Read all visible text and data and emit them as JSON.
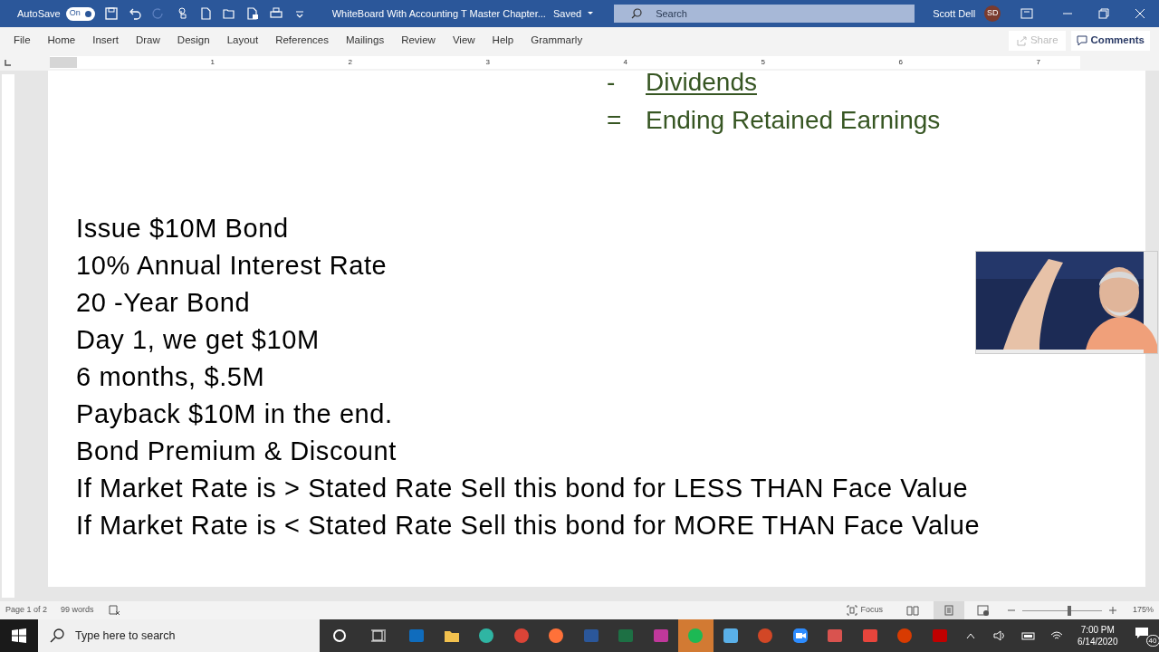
{
  "title_bar": {
    "autosave_label": "AutoSave",
    "autosave_on": true,
    "autosave_state": "On",
    "document_title": "WhiteBoard With Accounting T Master Chapter...",
    "save_status": "Saved",
    "search_placeholder": "Search",
    "user_name": "Scott Dell",
    "user_initials": "SD"
  },
  "ribbon": {
    "tabs": [
      "File",
      "Home",
      "Insert",
      "Draw",
      "Design",
      "Layout",
      "References",
      "Mailings",
      "Review",
      "View",
      "Help",
      "Grammarly"
    ],
    "share": {
      "label": "Share",
      "disabled": true
    },
    "comments": "Comments"
  },
  "ruler": {
    "numbers": [
      "1",
      "2",
      "3",
      "4",
      "5",
      "6",
      "7"
    ]
  },
  "document": {
    "summary_lines": [
      {
        "symbol": "-",
        "text": "Dividends",
        "underlined": true
      },
      {
        "symbol": "=",
        "text": "Ending Retained Earnings",
        "underlined": false
      }
    ],
    "lines": [
      "Issue $10M Bond",
      "10% Annual Interest Rate",
      "20 -Year Bond",
      "Day 1, we get $10M",
      "6 months, $.5M",
      "Payback $10M in the end.",
      "Bond Premium & Discount",
      "If Market Rate is > Stated Rate Sell this bond for LESS THAN Face Value",
      "If Market Rate is < Stated Rate Sell this bond for MORE THAN Face Value"
    ]
  },
  "status_bar": {
    "page": "Page 1 of 2",
    "words": "99 words",
    "focus": "Focus",
    "zoom": {
      "level": 0.6
    },
    "zoom_percent": "175%"
  },
  "taskbar": {
    "search_placeholder": "Type here to search",
    "apps": [
      {
        "kind": "outlook",
        "color": "#0f6cbd",
        "selected": false
      },
      {
        "kind": "explorer",
        "color": "#f2c14e",
        "selected": false
      },
      {
        "kind": "edge",
        "color": "#2fb5a3",
        "selected": false
      },
      {
        "kind": "chrome",
        "color": "#db4437",
        "selected": false
      },
      {
        "kind": "firefox",
        "color": "#ff7139",
        "selected": false
      },
      {
        "kind": "word",
        "color": "#2b579a",
        "selected": false
      },
      {
        "kind": "excel",
        "color": "#1d7044",
        "selected": false
      },
      {
        "kind": "paint",
        "color": "#c0389b",
        "selected": false
      },
      {
        "kind": "spotify",
        "color": "#1db954",
        "selected": true
      },
      {
        "kind": "ide",
        "color": "#5ab0e8",
        "selected": false
      },
      {
        "kind": "powerpoint",
        "color": "#d24726",
        "selected": false
      },
      {
        "kind": "zoom",
        "color": "#2d8cff",
        "selected": false
      },
      {
        "kind": "snip",
        "color": "#d9534f",
        "selected": false
      },
      {
        "kind": "snagit",
        "color": "#e8453c",
        "selected": false
      },
      {
        "kind": "office",
        "color": "#d83b01",
        "selected": false
      },
      {
        "kind": "acrobat",
        "color": "#c00000",
        "selected": false
      }
    ],
    "time": "7:00 PM",
    "date": "6/14/2020",
    "notifications": "40"
  }
}
